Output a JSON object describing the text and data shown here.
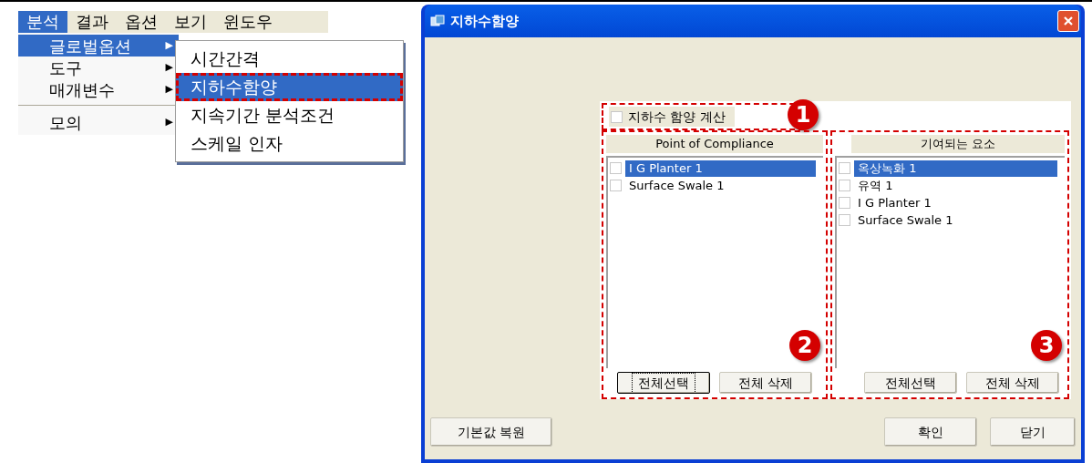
{
  "menubar": [
    {
      "label": "분석",
      "selected": true
    },
    {
      "label": "결과",
      "selected": false
    },
    {
      "label": "옵션",
      "selected": false
    },
    {
      "label": "보기",
      "selected": false
    },
    {
      "label": "윈도우",
      "selected": false
    }
  ],
  "menu": [
    {
      "kind": "item",
      "label": "글로벌옵션",
      "selected": true,
      "arrow": "▶"
    },
    {
      "kind": "item",
      "label": "도구",
      "selected": false,
      "arrow": "▶"
    },
    {
      "kind": "item",
      "label": "매개변수",
      "selected": false,
      "arrow": "▶"
    },
    {
      "kind": "separator"
    },
    {
      "kind": "item",
      "label": "모의",
      "selected": false,
      "arrow": "▶"
    }
  ],
  "submenu": [
    {
      "label": "시간간격",
      "selected": false,
      "marked": false
    },
    {
      "label": "지하수함양",
      "selected": true,
      "marked": true
    },
    {
      "label": "지속기간 분석조건",
      "selected": false,
      "marked": false
    },
    {
      "label": "스케일 인자",
      "selected": false,
      "marked": false
    }
  ],
  "dialog": {
    "title": "지하수함양",
    "calc_checkbox": {
      "label": "지하수 함양 계산",
      "checked": false,
      "callout": "1"
    },
    "lists": [
      {
        "header": "Point of Compliance",
        "callout": "2",
        "items": [
          {
            "label": "I G Planter  1",
            "selected": true,
            "checked": false
          },
          {
            "label": "Surface Swale 1",
            "selected": false,
            "checked": false
          }
        ],
        "buttons": [
          {
            "label": "전체선택",
            "focused": true
          },
          {
            "label": "전체 삭제",
            "focused": false
          }
        ]
      },
      {
        "header": "기여되는 요소",
        "callout": "3",
        "items": [
          {
            "label": "옥상녹화 1",
            "selected": true,
            "checked": false
          },
          {
            "label": "유역  1",
            "selected": false,
            "checked": false
          },
          {
            "label": "I G Planter  1",
            "selected": false,
            "checked": false
          },
          {
            "label": "Surface Swale 1",
            "selected": false,
            "checked": false
          }
        ],
        "buttons": [
          {
            "label": "전체선택",
            "focused": false
          },
          {
            "label": "전체 삭제",
            "focused": false
          }
        ]
      }
    ],
    "reset_button": "기본값 복원",
    "ok_button": "확인",
    "close_button": "닫기"
  }
}
